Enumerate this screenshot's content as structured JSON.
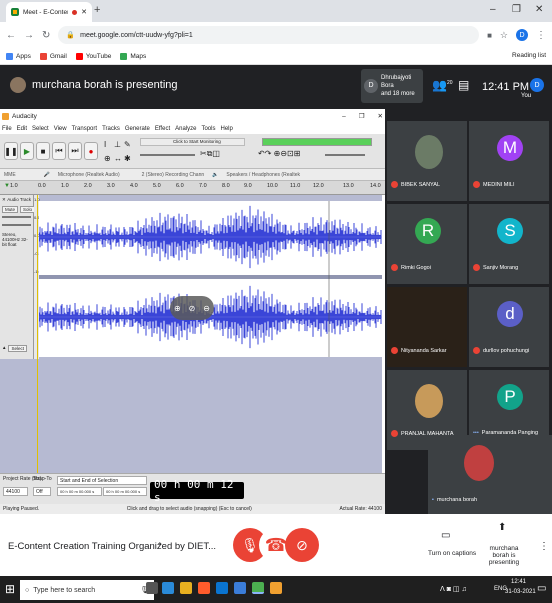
{
  "browser": {
    "tab_title": "Meet - E-Content Creation",
    "new_tab": "+",
    "url": "meet.google.com/ctt-uudw-yfg?pli=1",
    "profile_initial": "D",
    "bookmarks": [
      {
        "label": "Apps",
        "color": "#4285f4"
      },
      {
        "label": "Gmail",
        "color": "#ea4335"
      },
      {
        "label": "YouTube",
        "color": "#ff0000"
      },
      {
        "label": "Maps",
        "color": "#34a853"
      }
    ],
    "reading_list": "Reading list"
  },
  "meet_header": {
    "presenting": "murchana borah is presenting",
    "others_name": "Dhrubajyoti Bora",
    "others_more": "and 18 more",
    "others_initial": "D",
    "participant_count": "20",
    "time": "12:41 PM",
    "you_label": "You",
    "you_initial": "D"
  },
  "audacity": {
    "title": "Audacity",
    "menu": [
      "File",
      "Edit",
      "Select",
      "View",
      "Transport",
      "Tracks",
      "Generate",
      "Effect",
      "Analyze",
      "Tools",
      "Help"
    ],
    "monitor": "Click to Start Monitoring",
    "host": "MME",
    "mic": "Microphone (Realtek Audio)",
    "channels": "2 (Stereo) Recording Chann",
    "speaker": "Speakers / Headphones (Realtek",
    "ruler": [
      "1.0",
      "0.0",
      "1.0",
      "2.0",
      "3.0",
      "4.0",
      "5.0",
      "6.0",
      "7.0",
      "8.0",
      "9.0",
      "10.0",
      "11.0",
      "12.0",
      "13.0",
      "14.0"
    ],
    "track": {
      "name": "Audio Track",
      "mute": "Mute",
      "solo": "Solo",
      "info": "Stereo, 44100Hz 32-bit float",
      "select": "Select",
      "scale": [
        "1.0",
        "0.5",
        "0.0",
        "-0.5",
        "-1.0"
      ]
    },
    "project_rate_label": "Project Rate (Hz)",
    "project_rate": "44100",
    "snap_label": "Snap-To",
    "snap": "Off",
    "selection_label": "Start and End of Selection",
    "sel_start": "00 h 00 m 00.000 s",
    "sel_end": "00 h 00 m 00.000 s",
    "time_display": "00 h 00 m 12 s",
    "status_left": "Playing Paused.",
    "status_mid": "Click and drag to select audio (snapping) (Esc to cancel)",
    "status_right": "Actual Rate: 44100"
  },
  "participants": [
    {
      "name": "BIBEK SANYAL",
      "initial": "",
      "color": "#6b7b66",
      "photo": true
    },
    {
      "name": "MEDINI MILI",
      "initial": "M",
      "color": "#a142f4",
      "photo": false
    },
    {
      "name": "Rimki Gogoi",
      "initial": "R",
      "color": "#34a853",
      "photo": false
    },
    {
      "name": "Sanjiv Morang",
      "initial": "S",
      "color": "#12b5cb",
      "photo": false
    },
    {
      "name": "Nityananda Sarkar",
      "initial": "",
      "color": "#2a2118",
      "photo": true
    },
    {
      "name": "durllov pohuchungi",
      "initial": "d",
      "color": "#5b5fc7",
      "photo": false
    },
    {
      "name": "PRANJAL MAHANTA",
      "initial": "",
      "color": "#c79a5a",
      "photo": true
    },
    {
      "name": "Paramananda Panging",
      "initial": "P",
      "color": "#12a38a",
      "photo": false
    },
    {
      "name": "murchana borah",
      "initial": "",
      "color": "#c04040",
      "photo": true
    }
  ],
  "meet_bar": {
    "meeting_name": "E-Content Creation Training Organized by DIET...",
    "captions_label": "Turn on captions",
    "presenting_label": "murchana borah is presenting"
  },
  "taskbar": {
    "search_placeholder": "Type here to search",
    "lang": "ENG",
    "time": "12:41",
    "date": "31-03-2021"
  }
}
